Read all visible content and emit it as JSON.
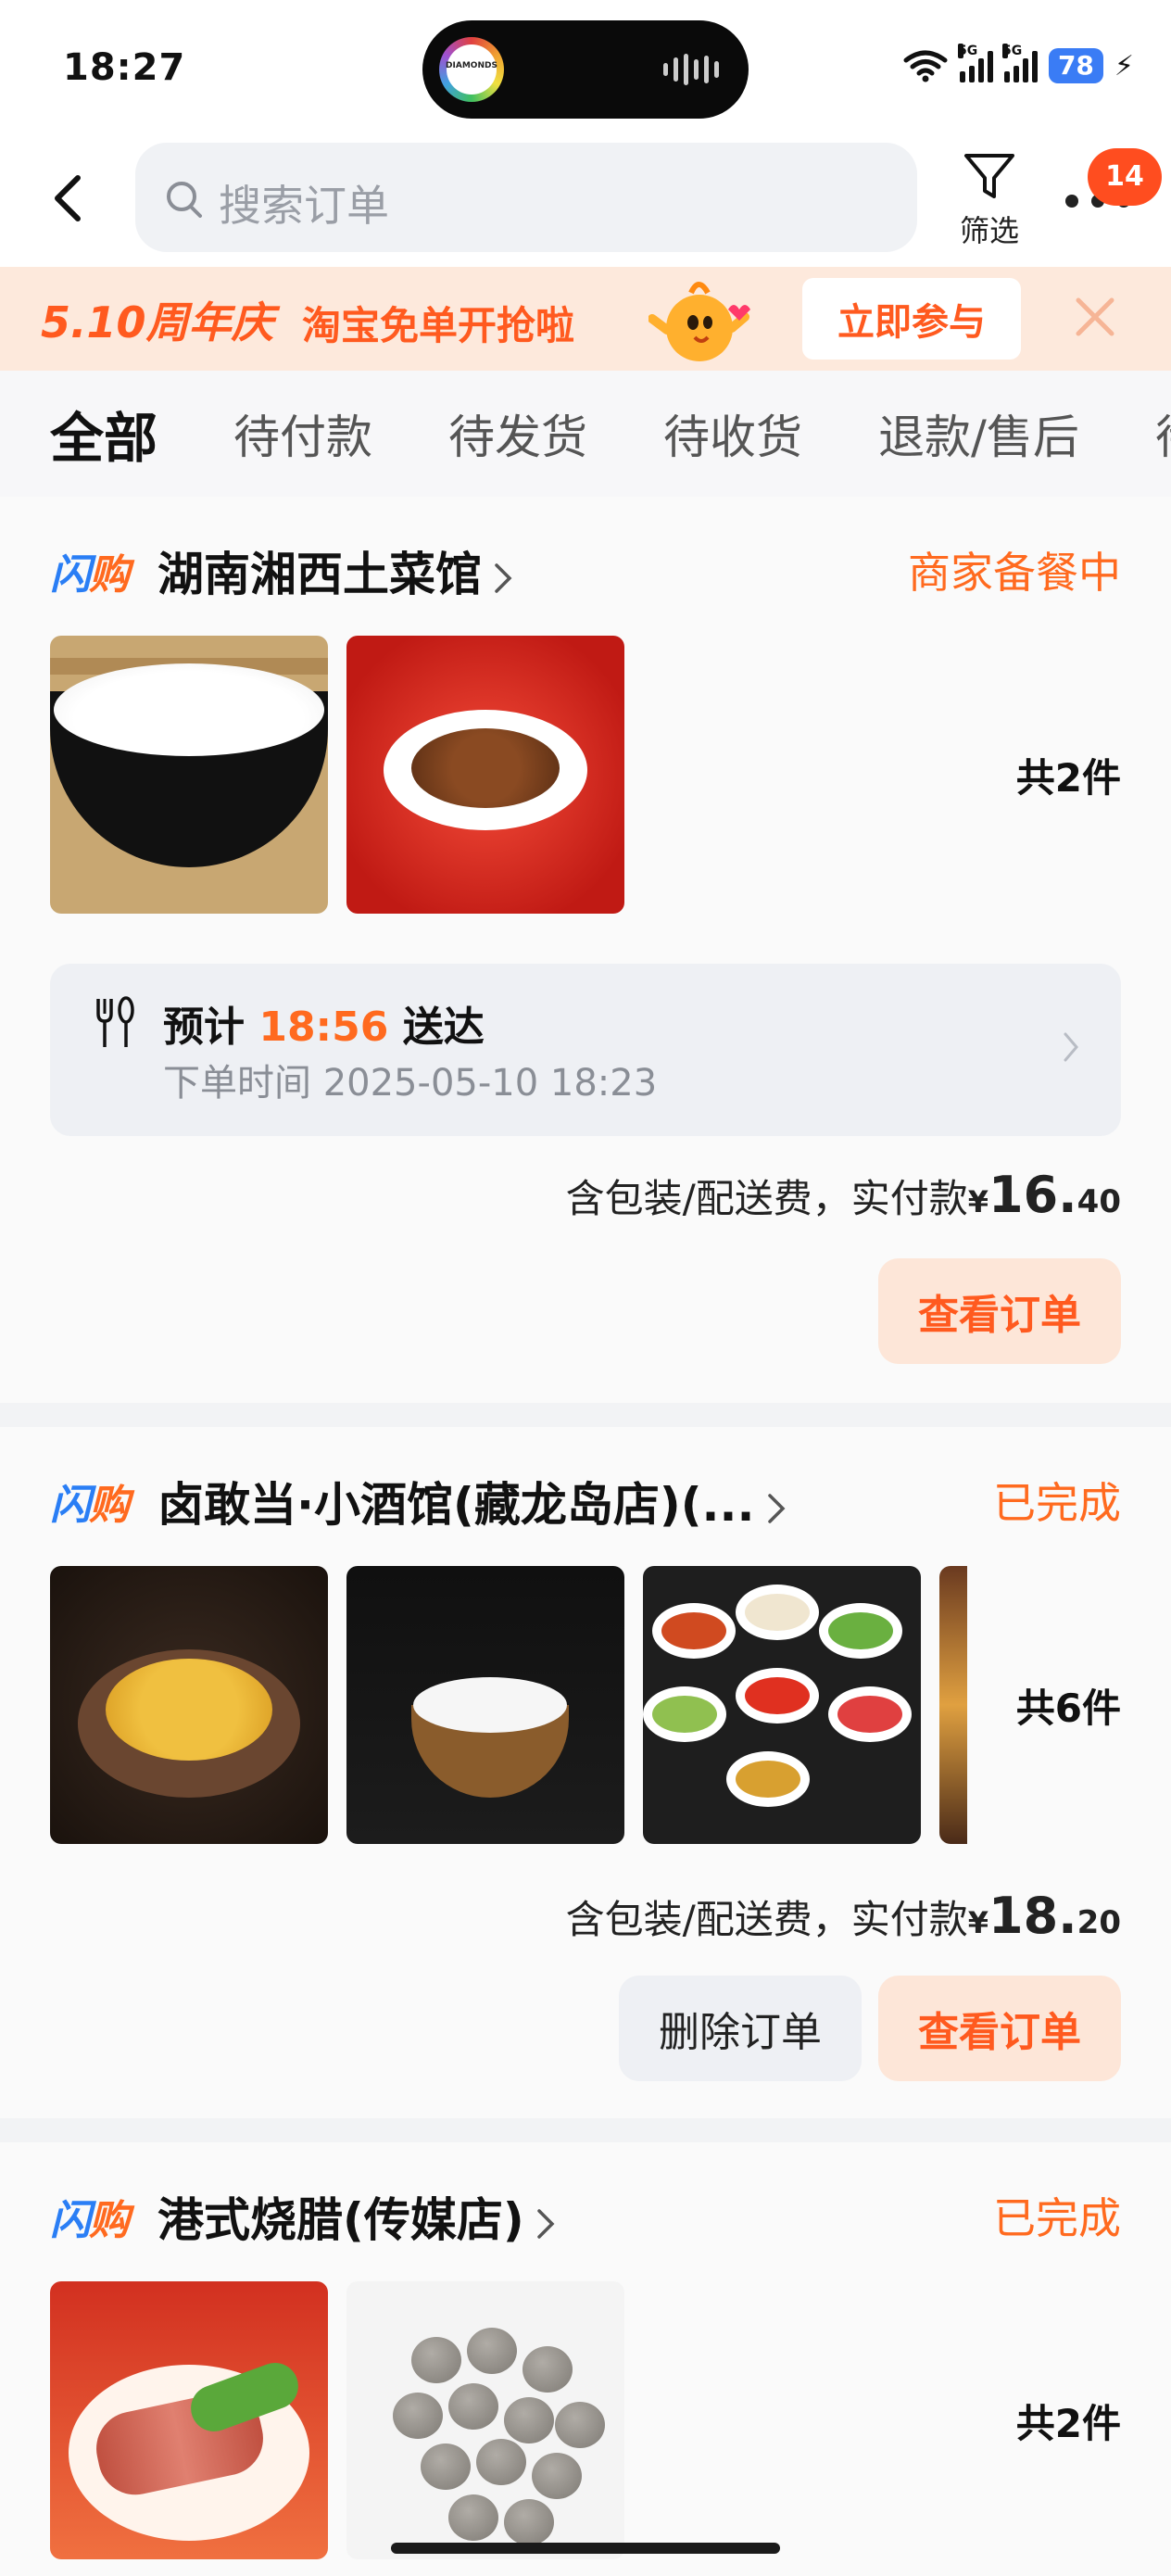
{
  "status_bar": {
    "time": "18:27",
    "island_logo_text": "DIAMONDS",
    "signal_labels": [
      "5G",
      "5G"
    ],
    "battery": "78",
    "icons": [
      "wifi-icon",
      "signal-icon",
      "battery-icon",
      "charging-icon"
    ]
  },
  "header": {
    "back_icon": "chevron-left-icon",
    "search_placeholder": "搜索订单",
    "filter_label": "筛选",
    "more_badge": "14"
  },
  "promo": {
    "title": "5.10周年庆",
    "subtitle": "淘宝免单开抢啦",
    "button": "立即参与",
    "accent_color": "#ff5a1f"
  },
  "tabs": [
    {
      "label": "全部",
      "active": true
    },
    {
      "label": "待付款",
      "active": false
    },
    {
      "label": "待发货",
      "active": false
    },
    {
      "label": "待收货",
      "active": false
    },
    {
      "label": "退款/售后",
      "active": false
    },
    {
      "label": "待",
      "active": false
    }
  ],
  "orders": [
    {
      "brand_a": "闪",
      "brand_b": "购",
      "shop": "湖南湘西土菜馆",
      "status": "商家备餐中",
      "item_count": "共2件",
      "images": [
        "rice-bowl",
        "stir-fried-pork"
      ],
      "eta_prefix": "预计",
      "eta_time": "18:56",
      "eta_suffix": "送达",
      "order_time": "下单时间 2025-05-10 18:23",
      "price_label": "含包装/配送费，实付款",
      "price_symbol": "¥",
      "price_int": "16.",
      "price_dec": "40",
      "view_button": "查看订单"
    },
    {
      "brand_a": "闪",
      "brand_b": "购",
      "shop": "卤敢当·小酒馆(藏龙岛店)(...",
      "status": "已完成",
      "item_count": "共6件",
      "images": [
        "steamed-egg-dish",
        "rice-bowl",
        "sauce-dishes",
        "partial-dish"
      ],
      "price_label": "含包装/配送费，实付款",
      "price_symbol": "¥",
      "price_int": "18.",
      "price_dec": "20",
      "delete_button": "删除订单",
      "view_button": "查看订单"
    },
    {
      "brand_a": "闪",
      "brand_b": "购",
      "shop": "港式烧腊(传媒店)",
      "status": "已完成",
      "item_count": "共2件",
      "images": [
        "roast-sausage-plate",
        "meatballs"
      ]
    }
  ]
}
